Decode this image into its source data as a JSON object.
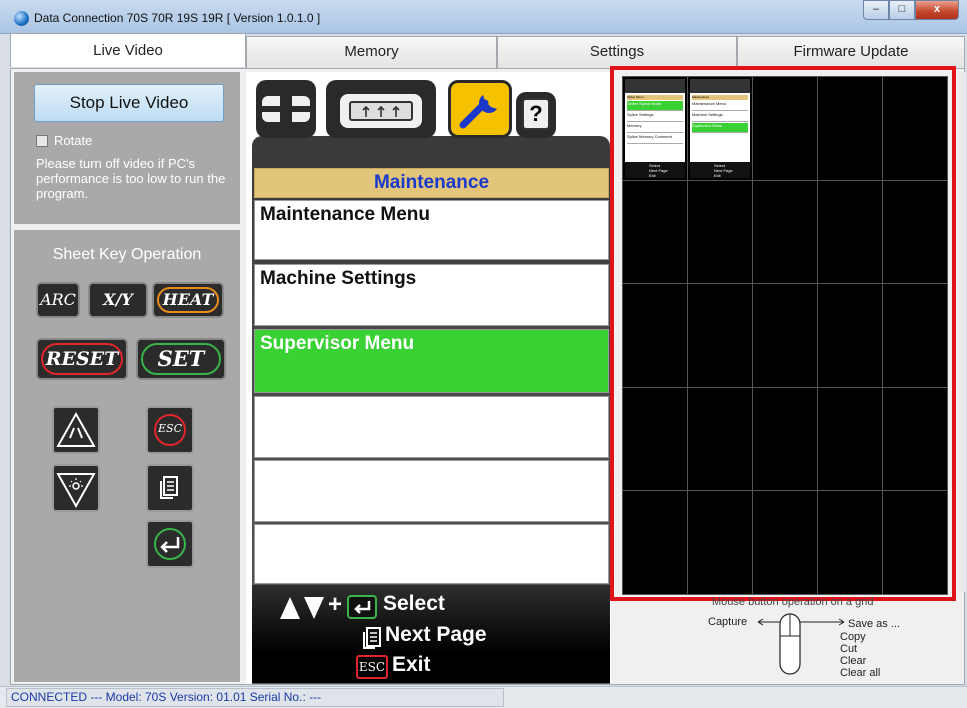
{
  "window": {
    "title": "Data Connection 70S 70R 19S 19R   [ Version 1.0.1.0 ]",
    "min_glyph": "–",
    "max_glyph": "□",
    "close_glyph": "x"
  },
  "tabs": [
    {
      "label": "Live Video",
      "active": true
    },
    {
      "label": "Memory",
      "active": false
    },
    {
      "label": "Settings",
      "active": false
    },
    {
      "label": "Firmware Update",
      "active": false
    }
  ],
  "live_panel": {
    "stop_label": "Stop Live Video",
    "rotate_label": "Rotate",
    "rotate_checked": false,
    "notice": "Please turn off video if PC's performance is too low to run the program."
  },
  "keys": {
    "title": "Sheet Key Operation",
    "arc": "ARC",
    "xy": "X/Y",
    "heat": "HEAT",
    "reset": "RESET",
    "set": "SET",
    "esc": "ESC"
  },
  "menu": {
    "header": "Maintenance",
    "items": [
      {
        "label": "Maintenance Menu",
        "selected": false
      },
      {
        "label": "Machine Settings",
        "selected": false
      },
      {
        "label": "Supervisor Menu",
        "selected": true
      },
      {
        "label": "",
        "selected": false
      },
      {
        "label": "",
        "selected": false
      },
      {
        "label": "",
        "selected": false
      }
    ],
    "help_glyph": "?",
    "hint_select": "Select",
    "hint_next": "Next Page",
    "hint_exit": "Exit",
    "hint_esc": "ESC",
    "hint_plus": "+"
  },
  "thumbnails": [
    {
      "header": "Splice Menu",
      "lines": [
        "Select Splice Mode",
        "Splice Settings",
        "Memory",
        "Splice Memory Comment"
      ],
      "selected_index": 0,
      "footer": [
        "Select",
        "Next Page",
        "Exit"
      ]
    },
    {
      "header": "Maintenance",
      "lines": [
        "Maintenance Menu",
        "Machine Settings",
        "Supervisor Menu"
      ],
      "selected_index": 2,
      "footer": [
        "Select",
        "Next Page",
        "Exit"
      ]
    }
  ],
  "mouse_help": {
    "title": "Mouse button operation on a grid",
    "capture": "Capture",
    "save_as": "Save as ...",
    "copy": "Copy",
    "cut": "Cut",
    "clear": "Clear",
    "clear_all": "Clear all"
  },
  "status": {
    "text": "CONNECTED     ---  Model: 70S  Version: 01.01   Serial No.:                   ---"
  },
  "colors": {
    "accent_selected": "#3ad135",
    "header_gold": "#e2c47a",
    "header_text": "#1a3acb",
    "grid_highlight": "#e1131a"
  }
}
